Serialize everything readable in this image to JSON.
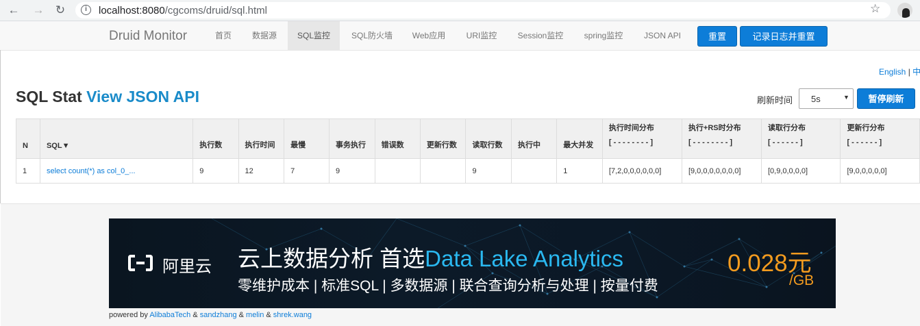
{
  "browser": {
    "url_host": "localhost:8080",
    "url_path": "/cgcoms/druid/sql.html",
    "back_icon": "arrow-left-icon",
    "forward_icon": "arrow-right-icon",
    "reload_icon": "reload-icon",
    "bookmark_icon": "star-icon"
  },
  "nav": {
    "brand": "Druid Monitor",
    "items": [
      "首页",
      "数据源",
      "SQL监控",
      "SQL防火墙",
      "Web应用",
      "URI监控",
      "Session监控",
      "spring监控",
      "JSON API"
    ],
    "active_index": 2,
    "reset_label": "重置",
    "log_reset_label": "记录日志并重置"
  },
  "lang": {
    "english": "English",
    "sep": "|",
    "chinese": "中"
  },
  "title": {
    "main": "SQL Stat",
    "link": "View JSON API"
  },
  "refresh": {
    "label": "刷新时间",
    "value": "5s",
    "pause_label": "暂停刷新"
  },
  "table": {
    "headers": [
      {
        "text": "N"
      },
      {
        "text": "SQL▼"
      },
      {
        "text": "执行数"
      },
      {
        "text": "执行时间"
      },
      {
        "text": "最慢"
      },
      {
        "text": "事务执行"
      },
      {
        "text": "错误数"
      },
      {
        "text": "更新行数"
      },
      {
        "text": "读取行数"
      },
      {
        "text": "执行中"
      },
      {
        "text": "最大并发"
      },
      {
        "text": "执行时间分布",
        "sub": "[ - - - - - - - - ]"
      },
      {
        "text": "执行+RS时分布",
        "sub": "[ - - - - - - - - ]"
      },
      {
        "text": "读取行分布",
        "sub": "[ - - - - - - ]"
      },
      {
        "text": "更新行分布",
        "sub": "[ - - - - - - ]"
      }
    ],
    "rows": [
      [
        "1",
        "select count(*) as col_0_...",
        "9",
        "12",
        "7",
        "9",
        "",
        "",
        "9",
        "",
        "1",
        "[7,2,0,0,0,0,0,0]",
        "[9,0,0,0,0,0,0,0]",
        "[0,9,0,0,0,0]",
        "[9,0,0,0,0,0]"
      ]
    ]
  },
  "footer": {
    "banner": {
      "logo_text": "阿里云",
      "headline_a": "云上数据分析 首选",
      "headline_b": "Data Lake Analytics",
      "subline": "零维护成本 | 标准SQL | 多数据源 | 联合查询分析与处理 | 按量付费",
      "price": "0.028元",
      "unit": "/GB",
      "colors": {
        "accent": "#2ab8f0",
        "price": "#f39b1f"
      }
    },
    "powered": {
      "prefix": "powered by",
      "links": [
        "AlibabaTech",
        "sandzhang",
        "melin",
        "shrek.wang"
      ],
      "sep": "&"
    }
  },
  "colors": {
    "brand_blue": "#0d7dd8",
    "title_link": "#1a8bc9",
    "nav_bg": "#f8f8f8"
  }
}
